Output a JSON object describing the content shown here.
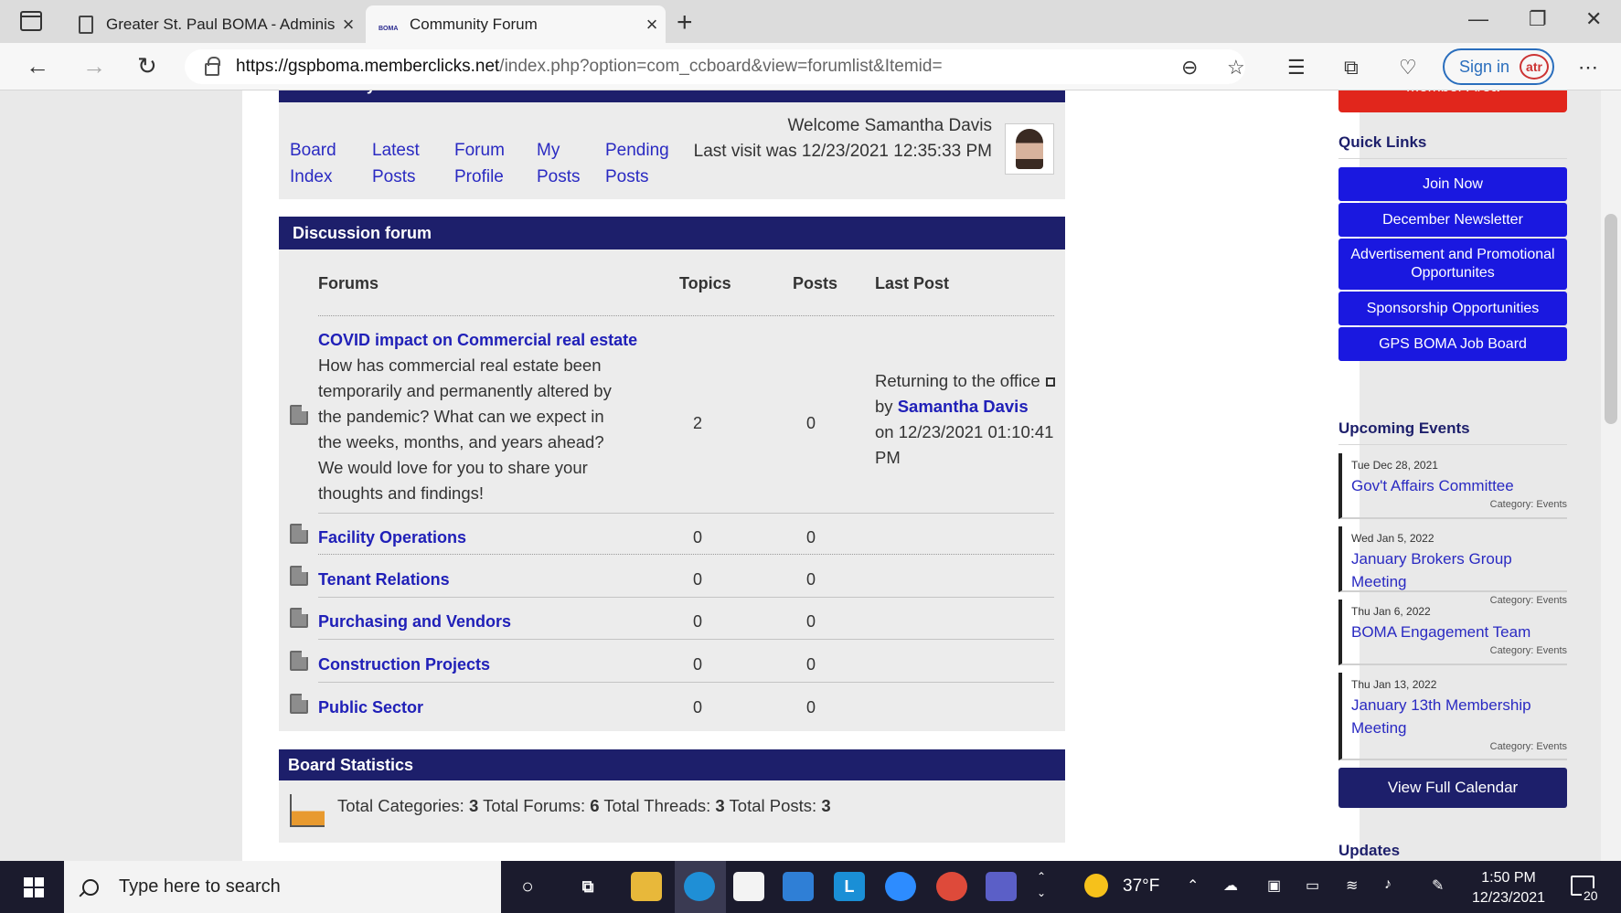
{
  "browser": {
    "tabs": [
      {
        "title": "Greater St. Paul BOMA - Adminis"
      },
      {
        "title": "Community Forum"
      }
    ],
    "url_host": "https://gspboma.memberclicks.net",
    "url_path": "/index.php?option=com_ccboard&view=forumlist&Itemid=",
    "signin_label": "Sign in"
  },
  "forum": {
    "section_title": "Community Forum",
    "nav": [
      "Board Index",
      "Latest Posts",
      "Forum Profile",
      "My Posts",
      "Pending Posts"
    ],
    "welcome_line": "Welcome Samantha Davis",
    "last_visit": "Last visit was 12/23/2021 12:35:33 PM"
  },
  "discussion": {
    "header": "Discussion forum",
    "columns": {
      "forums": "Forums",
      "topics": "Topics",
      "posts": "Posts",
      "last_post": "Last Post"
    },
    "featured": {
      "title": "COVID impact on Commercial real estate",
      "description": "How has commercial real estate been temporarily and permanently altered by the pandemic? What can we expect in the weeks, months, and years ahead? We would love for you to share your thoughts and findings!",
      "topics": "2",
      "posts": "0",
      "last_post_title": "Returning to the office",
      "by_label": "by",
      "last_post_user": "Samantha Davis",
      "on_label": "on 12/23/2021 01:10:41 PM"
    },
    "forums": [
      {
        "title": "Facility Operations",
        "topics": "0",
        "posts": "0"
      },
      {
        "title": "Tenant Relations",
        "topics": "0",
        "posts": "0"
      },
      {
        "title": "Purchasing and Vendors",
        "topics": "0",
        "posts": "0"
      },
      {
        "title": "Construction Projects",
        "topics": "0",
        "posts": "0"
      },
      {
        "title": "Public Sector",
        "topics": "0",
        "posts": "0"
      }
    ]
  },
  "stats": {
    "header": "Board Statistics",
    "cat_label": "Total Categories:",
    "cat_value": "3",
    "forums_label": "Total Forums:",
    "forums_value": "6",
    "threads_label": "Total Threads:",
    "threads_value": "3",
    "posts_label": "Total Posts:",
    "posts_value": "3"
  },
  "sidebar": {
    "member_area": "Member Area",
    "quick_links_title": "Quick Links",
    "quick_links": [
      "Join Now",
      "December Newsletter",
      "Advertisement and Promotional Opportunites",
      "Sponsorship Opportunities",
      "GPS BOMA Job Board"
    ],
    "events_title": "Upcoming Events",
    "events": [
      {
        "date": "Tue Dec 28, 2021",
        "title": "Gov't Affairs Committee",
        "category": "Category: Events"
      },
      {
        "date": "Wed Jan 5, 2022",
        "title": "January Brokers Group Meeting",
        "category": "Category: Events"
      },
      {
        "date": "Thu Jan 6, 2022",
        "title": "BOMA Engagement Team",
        "category": "Category: Events"
      },
      {
        "date": "Thu Jan 13, 2022",
        "title": "January 13th Membership Meeting",
        "category": "Category: Events"
      }
    ],
    "calendar_button": "View Full Calendar",
    "updates_title": "Updates"
  },
  "taskbar": {
    "search_placeholder": "Type here to search",
    "temperature": "37°F",
    "time": "1:50 PM",
    "date": "12/23/2021",
    "notification_count": "20"
  },
  "colors": {
    "navy": "#1d1f6b",
    "link": "#2020b8",
    "quicklink": "#1a18e0",
    "member": "#e1261c"
  }
}
